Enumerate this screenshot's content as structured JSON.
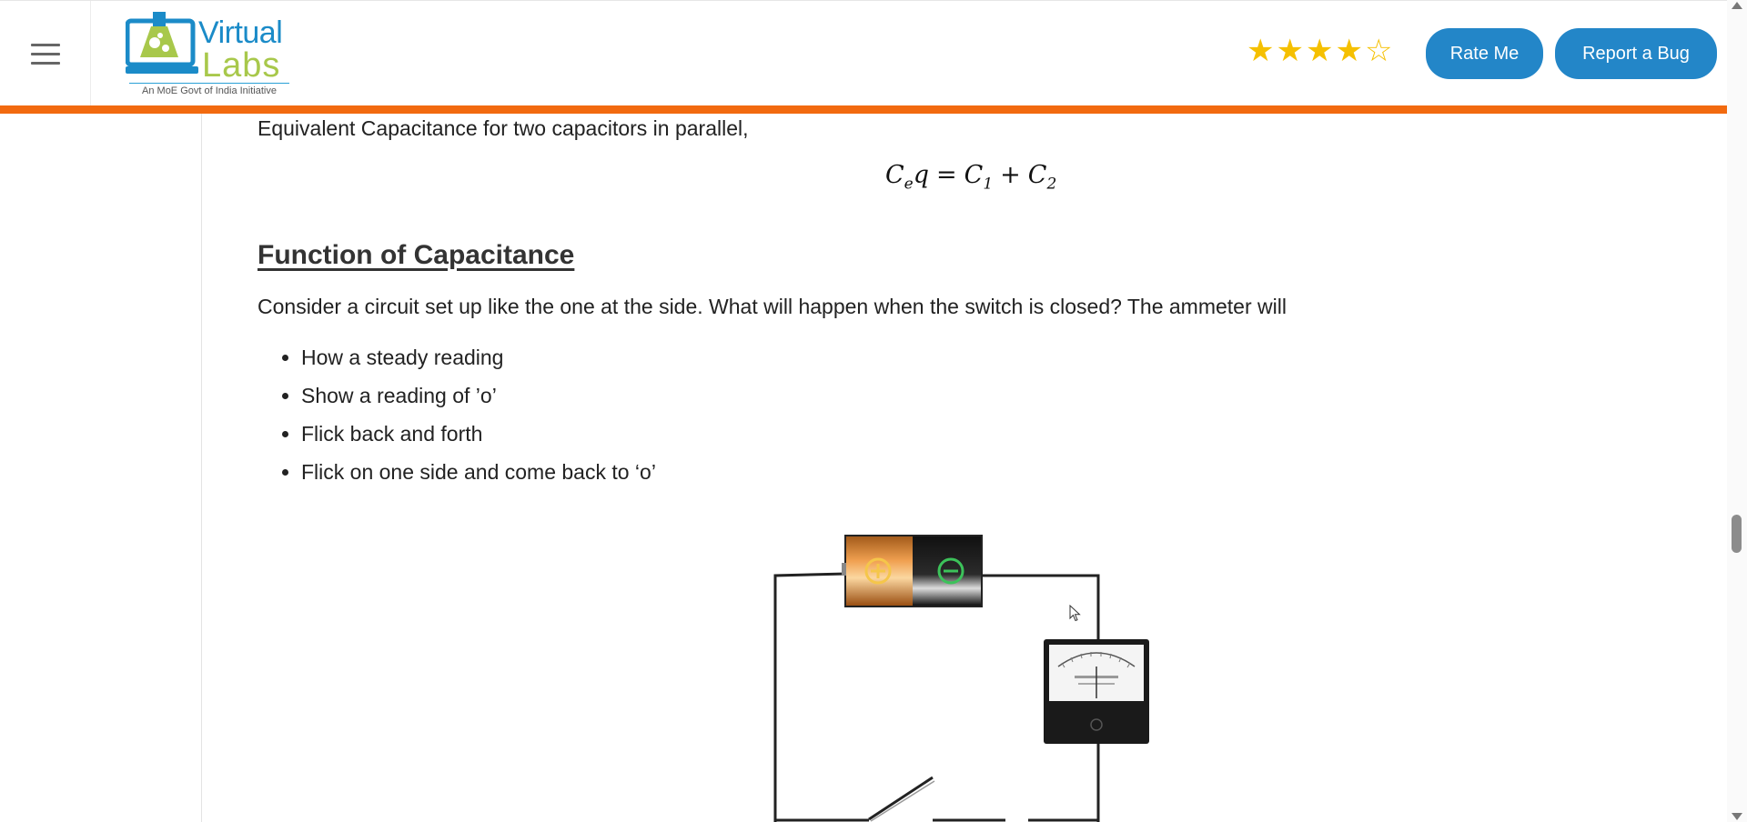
{
  "header": {
    "logo_word1": "Virtual",
    "logo_word2": "Labs",
    "logo_tagline": "An MoE Govt of India Initiative",
    "rating_stars_filled": 4,
    "rating_stars_total": 5,
    "rate_button": "Rate Me",
    "bug_button": "Report a Bug"
  },
  "colors": {
    "accent_blue": "#2386c8",
    "orange_bar": "#f26a0f",
    "star": "#f5c000"
  },
  "content": {
    "parallel_text": "Equivalent Capacitance for two capacitors in parallel,",
    "formula": {
      "lhs_base": "C",
      "lhs_sub": "e",
      "lhs_tail": "q",
      "equals": "=",
      "c1_base": "C",
      "c1_sub": "1",
      "plus": "+",
      "c2_base": "C",
      "c2_sub": "2"
    },
    "heading": "Function of Capacitance",
    "question": "Consider a circuit set up like the one at the side. What will happen when the switch is closed? The ammeter will",
    "options": [
      "How a steady reading",
      "Show a reading of ’o’",
      "Flick back and forth",
      "Flick on one side and come back to ‘o’"
    ]
  },
  "icons": {
    "menu": "hamburger-icon",
    "battery": "battery-icon",
    "ammeter": "ammeter-icon",
    "switch": "switch-icon"
  }
}
